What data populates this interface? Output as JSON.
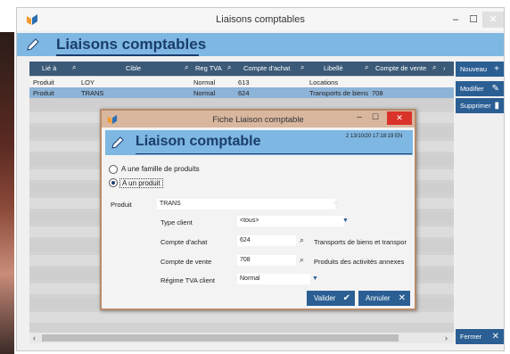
{
  "window": {
    "title": "Liaisons comptables",
    "min_glyph": "–",
    "max_glyph": "☐",
    "close_glyph": "✕"
  },
  "header": {
    "title": "Liaisons comptables"
  },
  "grid": {
    "columns": [
      "Lié à",
      "Cible",
      "Reg TVA",
      "Compte d'achat",
      "Libellé",
      "Compte de vente"
    ],
    "rows": [
      {
        "lie_a": "Produit",
        "cible": "LOY",
        "reg_tva": "Normal",
        "compte_achat": "613",
        "libelle": "Locations",
        "compte_vente": ""
      },
      {
        "lie_a": "Produit",
        "cible": "TRANS",
        "reg_tva": "Normal",
        "compte_achat": "624",
        "libelle": "Transports de biens",
        "compte_vente": "708"
      }
    ]
  },
  "side_buttons": {
    "nouveau": "Nouveau",
    "modifier": "Modifier",
    "supprimer": "Supprimer",
    "fermer": "Fermer"
  },
  "dialog": {
    "title": "Fiche Liaison comptable",
    "header_title": "Liaison comptable",
    "meta": "2  13/10/20 17:18:19  EN",
    "radio_famille": "A une famille de produits",
    "radio_produit": "A un produit",
    "produit_label": "Produit",
    "produit_value": "TRANS",
    "type_client_label": "Type client",
    "type_client_value": "<tous>",
    "compte_achat_label": "Compte d'achat",
    "compte_achat_value": "624",
    "compte_achat_desc": "Transports de biens et transpor",
    "compte_vente_label": "Compte de vente",
    "compte_vente_value": "708",
    "compte_vente_desc": "Produits des activités annexes",
    "regime_tva_label": "Régime TVA client",
    "regime_tva_value": "Normal",
    "valider": "Valider",
    "annuler": "Annuler"
  },
  "icons": {
    "search": "search-icon",
    "plus": "plus-icon",
    "pencil": "pencil-icon",
    "trash": "trash-icon",
    "check": "check-icon",
    "close": "close-icon"
  },
  "colors": {
    "accent": "#2b5f94",
    "header_band": "#7eb7e2",
    "grid_head": "#3b5a78",
    "selected_row": "#8db3d7",
    "dialog_close": "#d9332a"
  }
}
